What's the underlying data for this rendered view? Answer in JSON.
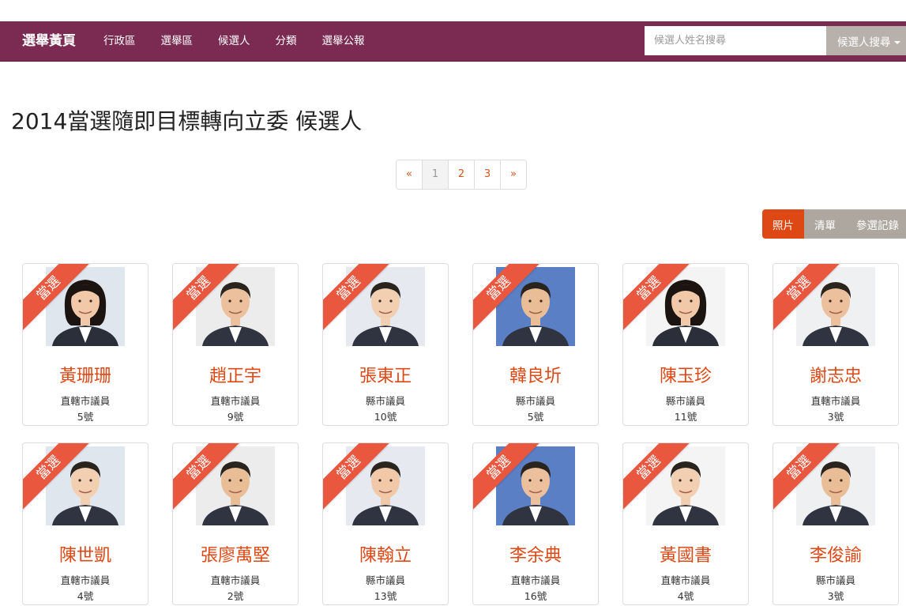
{
  "navbar": {
    "brand": "選舉黃頁",
    "links": [
      "行政區",
      "選舉區",
      "候選人",
      "分類",
      "選舉公報"
    ],
    "search_placeholder": "候選人姓名搜尋",
    "search_button": "候選人搜尋",
    "bg_color": "#7b2a52"
  },
  "page": {
    "title": "2014當選隨即目標轉向立委 候選人"
  },
  "pagination": {
    "prev": "«",
    "pages": [
      "1",
      "2",
      "3"
    ],
    "active": "1",
    "next": "»"
  },
  "view_buttons": {
    "photo": "照片",
    "list": "清單",
    "records": "參選記錄",
    "active": "photo"
  },
  "ribbon_text": "當選",
  "candidates": [
    {
      "name": "黃珊珊",
      "role": "直轄市議員",
      "number": "5號",
      "photo_icon": "female-portrait-icon"
    },
    {
      "name": "趙正宇",
      "role": "直轄市議員",
      "number": "9號",
      "photo_icon": "male-portrait-icon"
    },
    {
      "name": "張東正",
      "role": "縣市議員",
      "number": "10號",
      "photo_icon": "male-portrait-icon"
    },
    {
      "name": "韓良圻",
      "role": "縣市議員",
      "number": "5號",
      "photo_icon": "male-portrait-icon"
    },
    {
      "name": "陳玉珍",
      "role": "縣市議員",
      "number": "11號",
      "photo_icon": "female-portrait-icon"
    },
    {
      "name": "謝志忠",
      "role": "直轄市議員",
      "number": "3號",
      "photo_icon": "male-portrait-icon"
    },
    {
      "name": "陳世凱",
      "role": "直轄市議員",
      "number": "4號",
      "photo_icon": "male-portrait-icon"
    },
    {
      "name": "張廖萬堅",
      "role": "直轄市議員",
      "number": "2號",
      "photo_icon": "male-portrait-icon"
    },
    {
      "name": "陳翰立",
      "role": "縣市議員",
      "number": "13號",
      "photo_icon": "male-portrait-icon"
    },
    {
      "name": "李余典",
      "role": "直轄市議員",
      "number": "16號",
      "photo_icon": "male-portrait-icon"
    },
    {
      "name": "黃國書",
      "role": "直轄市議員",
      "number": "4號",
      "photo_icon": "male-portrait-icon"
    },
    {
      "name": "李俊諭",
      "role": "縣市議員",
      "number": "3號",
      "photo_icon": "male-portrait-icon"
    }
  ]
}
